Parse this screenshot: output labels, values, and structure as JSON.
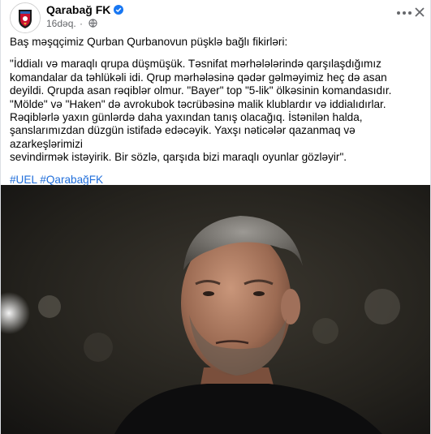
{
  "post": {
    "page_name": "Qarabağ FK",
    "timestamp": "16dəq.",
    "intro": "Baş məşqçimiz Qurban Qurbanovun püşklə bağlı fikirləri:",
    "quote_lines": [
      "\"İddialı və maraqlı qrupa düşmüşük. Təsnifat mərhələlərində qarşılaşdığımız",
      "komandalar da təhlükəli idi. Qrup mərhələsinə qədər gəlməyimiz heç də asan",
      "deyildi. Qrupda asan rəqiblər olmur. \"Bayer\" top \"5-lik\" ölkəsinin komandasıdır.",
      "\"Mölde\" və \"Haken\" də avrokubok təcrübəsinə malik klublardır və iddialıdırlar.",
      "Rəqiblərlə yaxın günlərdə daha yaxından tanış olacağıq. İstənilən halda,",
      "şanslarımızdan düzgün istifadə edəcəyik. Yaxşı nəticələr qazanmaq və azarkeşlərimizi",
      "sevindirmək istəyirik. Bir sözlə, qarşıda bizi maraqlı oyunlar gözləyir\"."
    ],
    "hashtags": [
      "#UEL",
      "#QarabağFK"
    ]
  },
  "icons": {
    "verified": "verified-badge-icon",
    "audience": "globe-icon",
    "more": "more-options-icon",
    "close": "close-icon"
  },
  "colors": {
    "accent": "#1877f2",
    "hashtag": "#216fdb",
    "meta": "#65676b"
  }
}
